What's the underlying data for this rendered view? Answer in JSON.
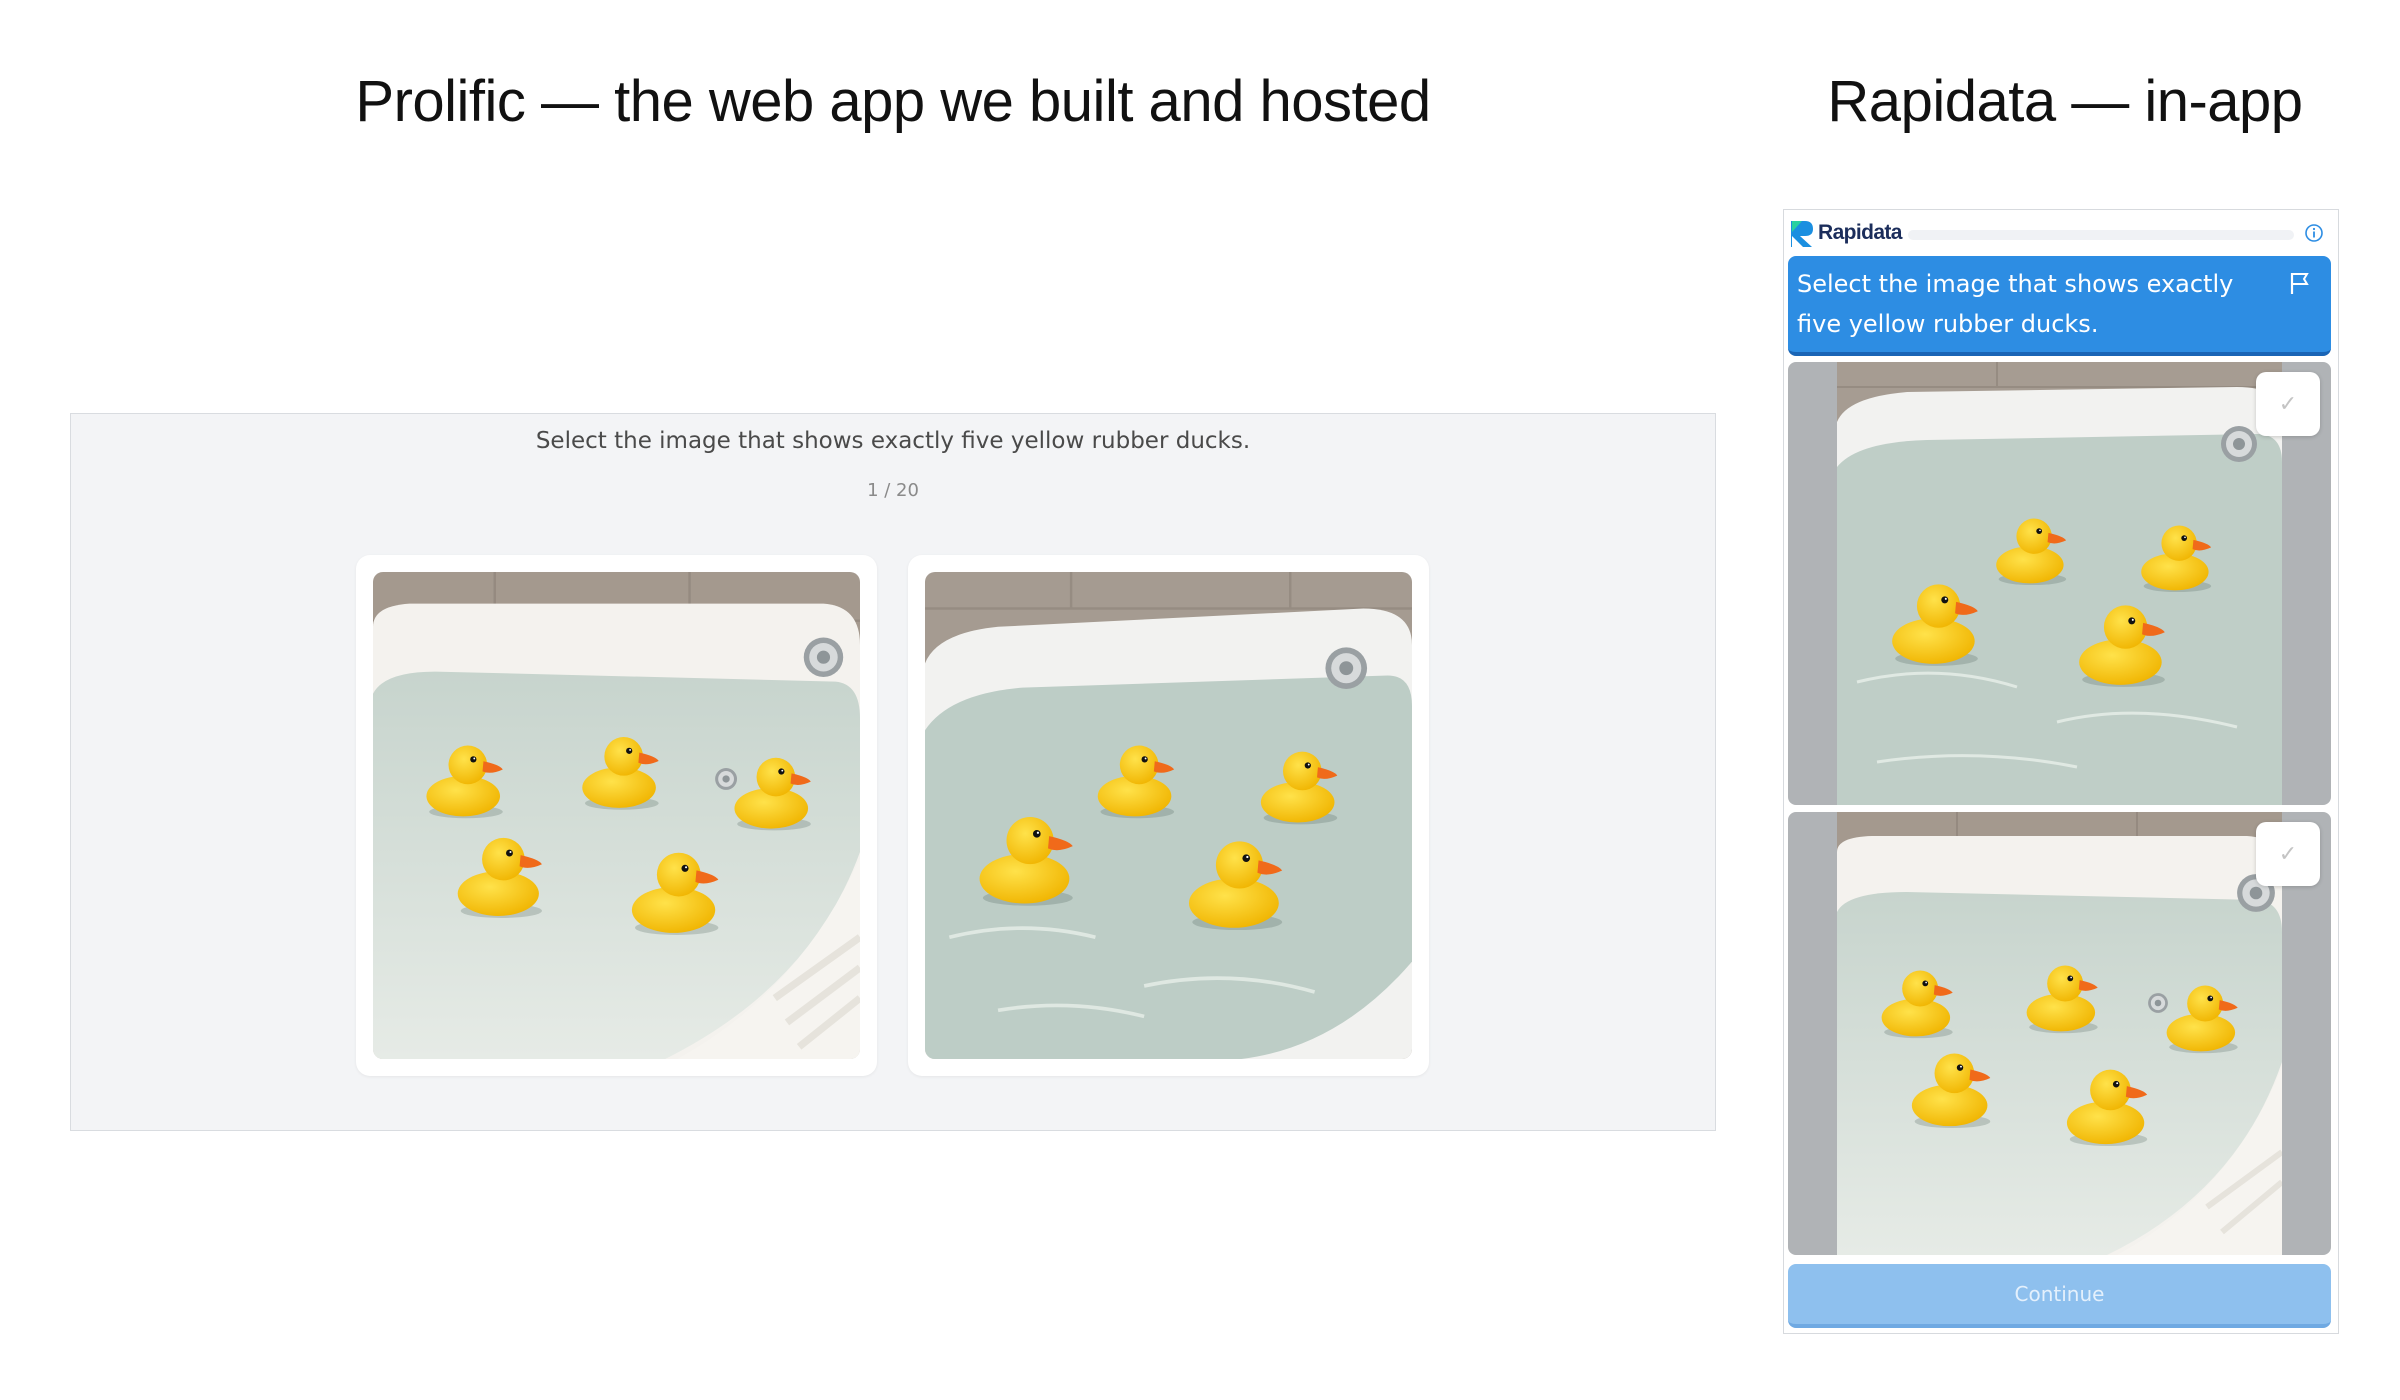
{
  "headings": {
    "left": "Prolific — the web app we built and hosted",
    "right": "Rapidata — in-app"
  },
  "prolific": {
    "prompt": "Select the image that shows exactly five yellow rubber ducks.",
    "counter": "1 / 20",
    "options": [
      {
        "image": "bathtub with five yellow rubber ducks"
      },
      {
        "image": "bathtub with four yellow rubber ducks"
      }
    ]
  },
  "rapidata": {
    "logo_text": "Rapidata",
    "info_icon": "info-icon",
    "banner_text": "Select the image that shows exactly five yellow rubber ducks.",
    "flag_icon": "flag-icon",
    "options": [
      {
        "image": "bathtub with four yellow rubber ducks",
        "check_icon": "check-icon"
      },
      {
        "image": "bathtub with five yellow rubber ducks",
        "check_icon": "check-icon"
      }
    ],
    "continue_label": "Continue"
  },
  "colors": {
    "rapidata_blue": "#2d8de3",
    "continue_disabled": "#8ec0ee",
    "panel_bg": "#f3f4f6",
    "duck_yellow": "#f7c600",
    "beak_orange": "#f06a1a"
  }
}
